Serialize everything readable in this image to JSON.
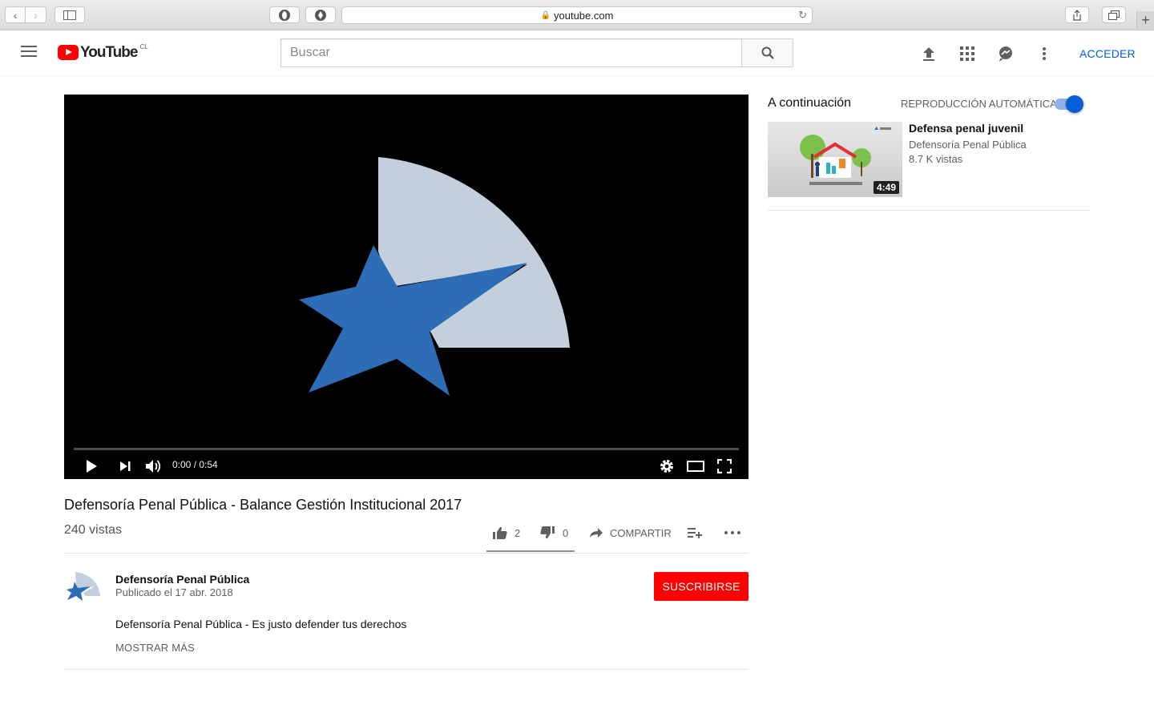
{
  "browser": {
    "url": "youtube.com"
  },
  "masthead": {
    "logo_text": "YouTube",
    "country_code": "CL",
    "search_placeholder": "Buscar",
    "signin_label": "ACCEDER"
  },
  "player": {
    "time_display": "0:00 / 0:54",
    "progress_fraction": 0.0
  },
  "video": {
    "title": "Defensoría Penal Pública - Balance Gestión Institucional 2017",
    "views": "240 vistas",
    "likes": "2",
    "dislikes": "0",
    "share_label": "COMPARTIR"
  },
  "owner": {
    "name": "Defensoría Penal Pública",
    "published": "Publicado el 17 abr. 2018",
    "subscribe_label": "SUSCRIBIRSE",
    "description": "Defensoría Penal Pública - Es justo defender tus derechos",
    "show_more_label": "MOSTRAR MÁS"
  },
  "sidebar": {
    "up_next_label": "A continuación",
    "autoplay_label": "REPRODUCCIÓN AUTOMÁTICA",
    "autoplay_on": true,
    "recommendations": [
      {
        "title": "Defensa penal juvenil",
        "channel": "Defensoría Penal Pública",
        "views": "8.7 K vistas",
        "duration": "4:49"
      }
    ]
  },
  "colors": {
    "accent_blue": "#065fd4",
    "subscribe_red": "#ff0000",
    "logo_star_blue": "#2d6db5",
    "logo_fan_gray": "#c3cfdc"
  }
}
